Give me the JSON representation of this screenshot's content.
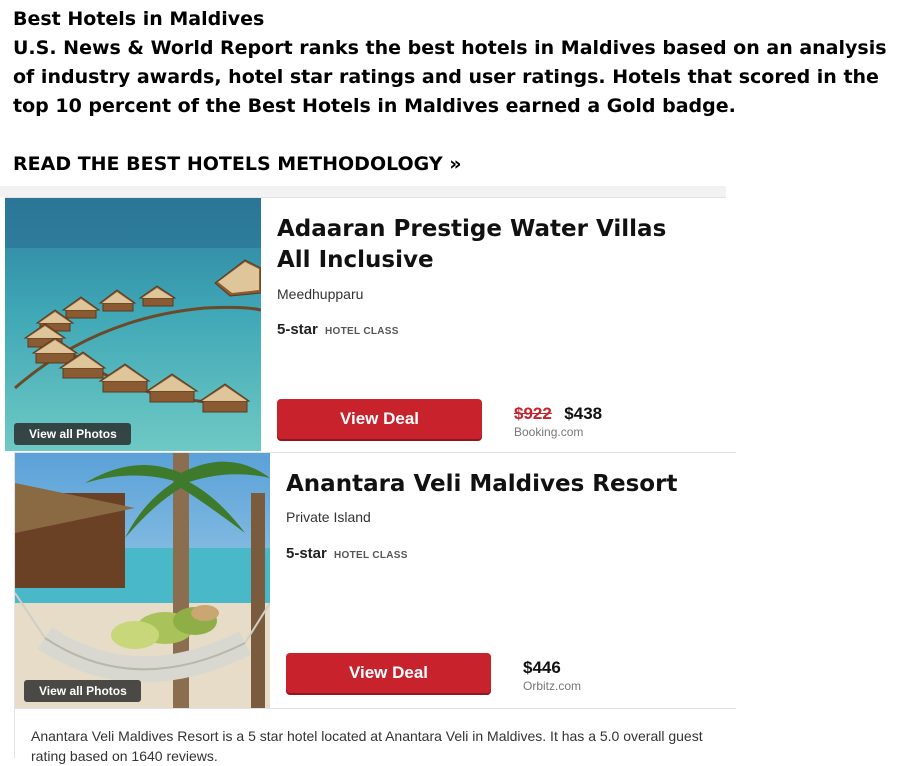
{
  "intro": {
    "title": "Best Hotels in Maldives",
    "description": "U.S. News & World Report ranks the best hotels in Maldives based on an analysis of industry awards, hotel star ratings and user ratings. Hotels that scored in the top 10 percent of the Best Hotels in Maldives earned a Gold badge.",
    "methodology_link": "READ THE BEST HOTELS METHODOLOGY »"
  },
  "hotels": [
    {
      "name": "Adaaran Prestige Water Villas All Inclusive",
      "location": "Meedhupparu",
      "star_rating": "5-star",
      "class_label": "HOTEL CLASS",
      "view_photos": "View all Photos",
      "deal_button": "View Deal",
      "old_price": "$922",
      "price": "$438",
      "provider": "Booking.com"
    },
    {
      "name": "Anantara Veli Maldives Resort",
      "location": "Private Island",
      "star_rating": "5-star",
      "class_label": "HOTEL CLASS",
      "view_photos": "View all Photos",
      "deal_button": "View Deal",
      "price": "$446",
      "provider": "Orbitz.com",
      "description": "Anantara Veli Maldives Resort is a 5 star hotel located at Anantara Veli in Maldives. It has a 5.0 overall guest rating based on 1640 reviews."
    }
  ],
  "colors": {
    "deal_button": "#c8222d",
    "strike_price": "#c8222d",
    "provider_text": "#777777"
  },
  "icons": [
    "overwater-villas-photo",
    "beach-hammock-photo"
  ]
}
